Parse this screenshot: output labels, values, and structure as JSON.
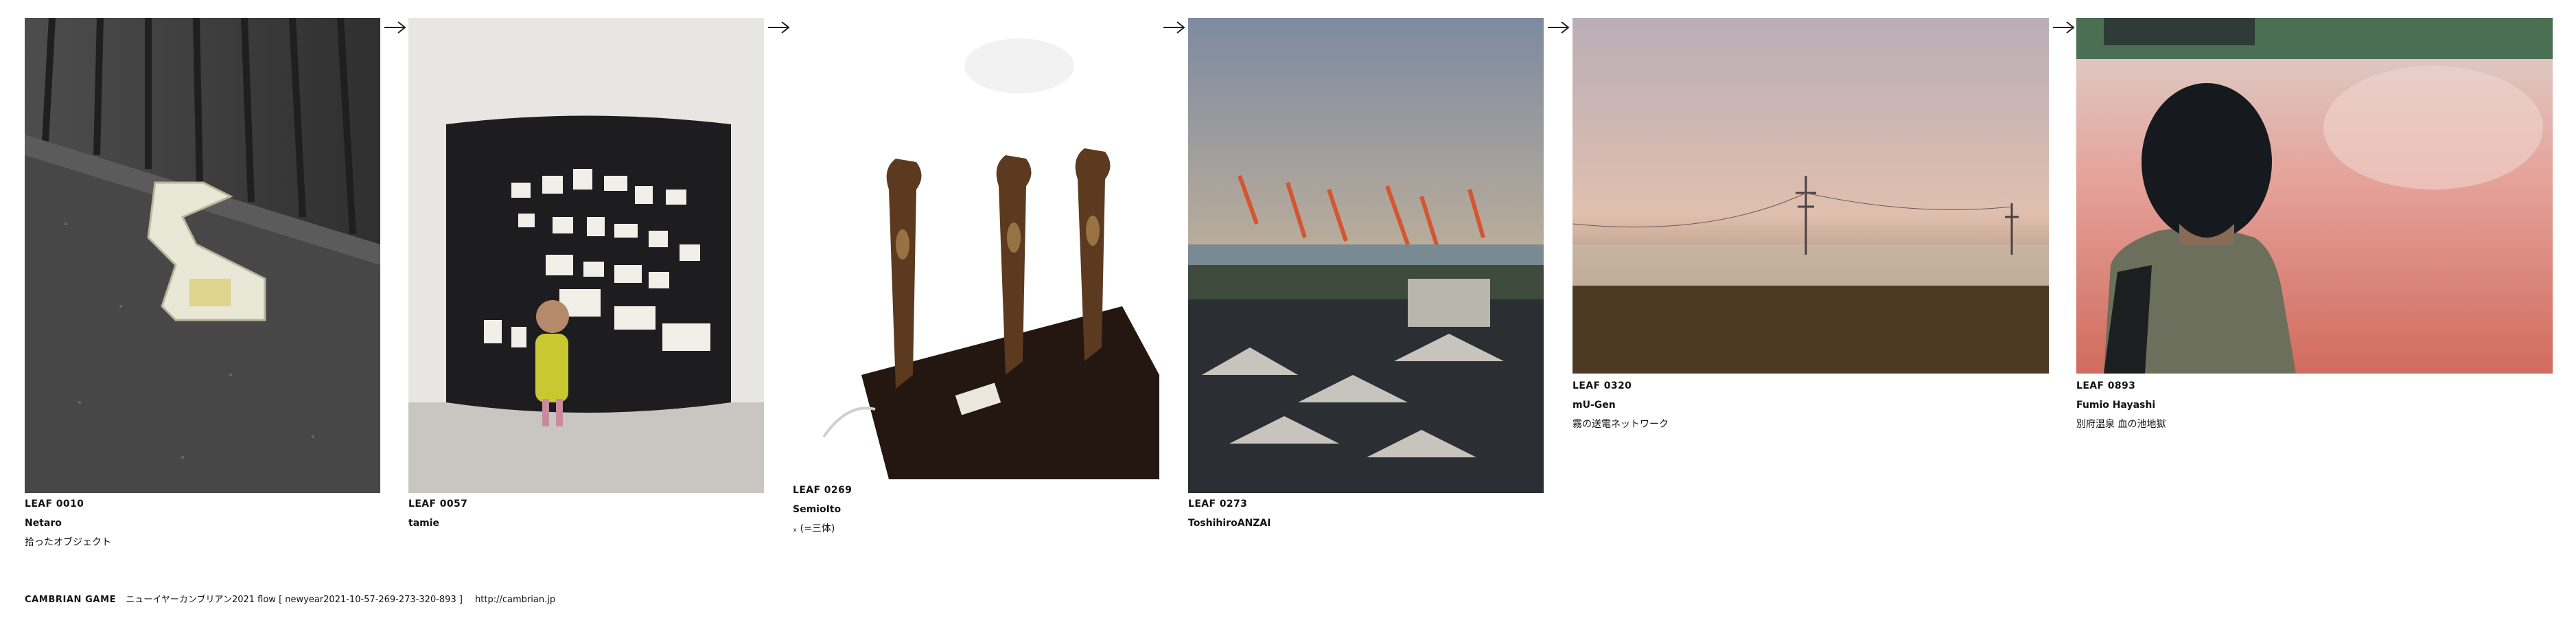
{
  "leaves": [
    {
      "id": "LEAF 0010",
      "author": "Netaro",
      "title": "拾ったオブジェクト"
    },
    {
      "id": "LEAF 0057",
      "author": "tamie",
      "title": ""
    },
    {
      "id": "LEAF 0269",
      "author": "SemioIto",
      "title": "ₓ (=三体)"
    },
    {
      "id": "LEAF 0273",
      "author": "ToshihiroANZAI",
      "title": ""
    },
    {
      "id": "LEAF 0320",
      "author": "mU-Gen",
      "title": "霧の送電ネットワーク"
    },
    {
      "id": "LEAF 0893",
      "author": "Fumio Hayashi",
      "title": "別府温泉 血の池地獄"
    }
  ],
  "footer": {
    "brand": "CAMBRIAN GAME",
    "text": "ニューイヤーカンブリアン2021 flow [ newyear2021-10-57-269-273-320-893 ]",
    "url": "http://cambrian.jp"
  },
  "icons": {
    "arrow": "right-arrow-icon"
  }
}
